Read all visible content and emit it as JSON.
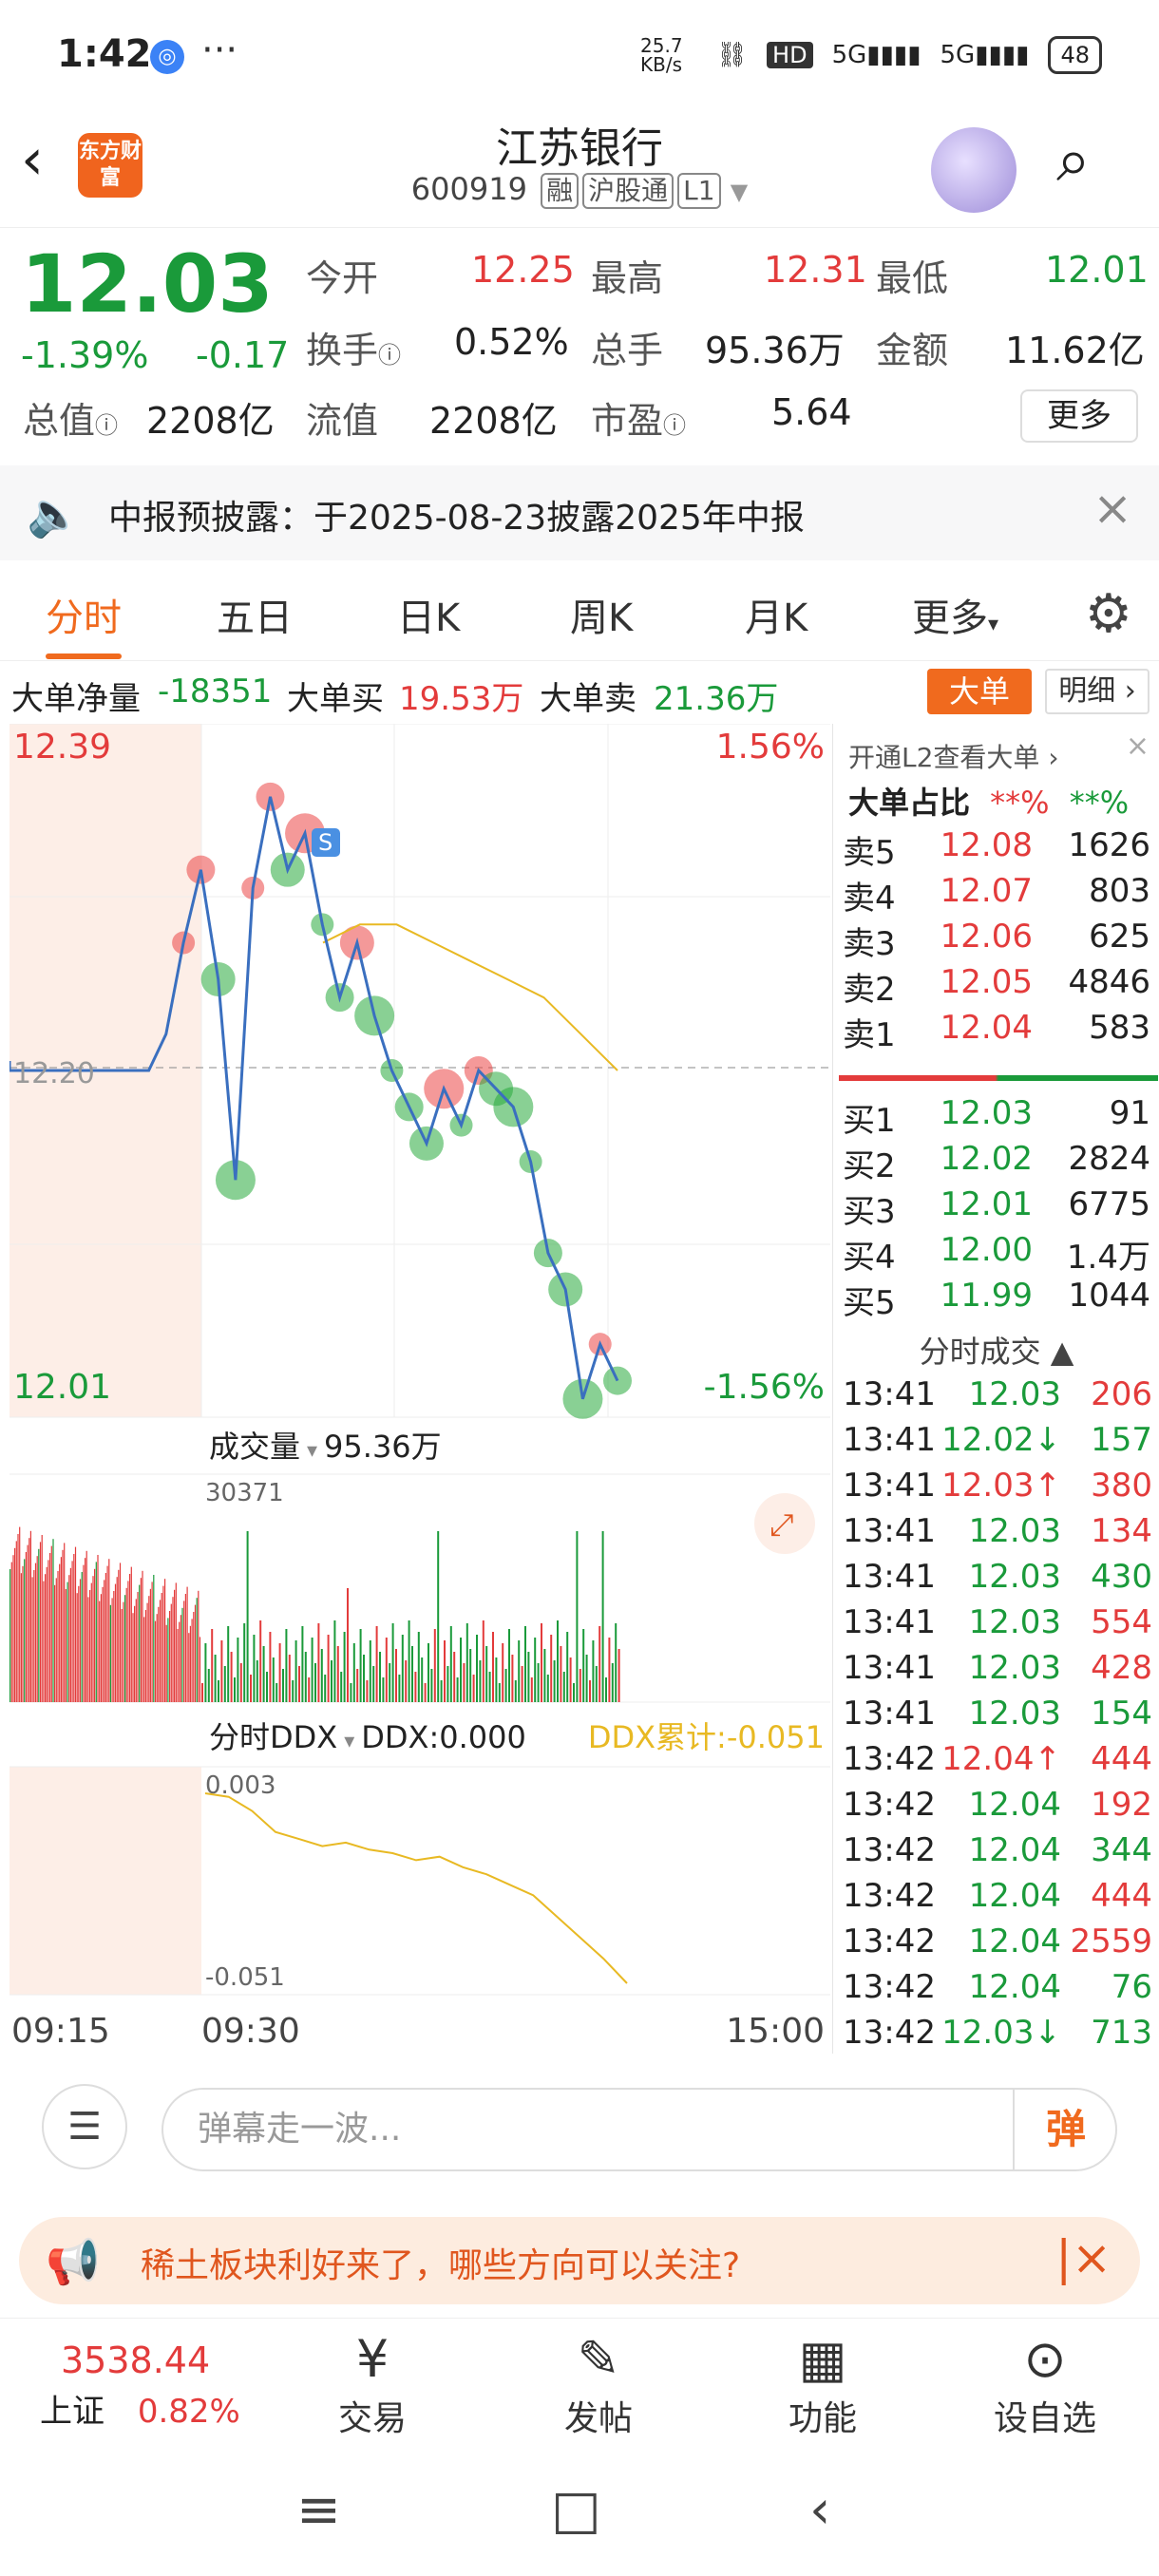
{
  "status_bar": {
    "time": "1:42",
    "dots": "···",
    "net_speed": "25.7 KB/s",
    "hd": "HD",
    "sig1": "5G",
    "sig2": "5G",
    "battery": "48"
  },
  "header": {
    "logo": "东方财富",
    "title": "江苏银行",
    "code": "600919",
    "tags": [
      "融",
      "沪股通",
      "L1"
    ]
  },
  "quote": {
    "price": "12.03",
    "change_pct": "-1.39%",
    "change": "-0.17",
    "fields": [
      {
        "label": "今开",
        "value": "12.25",
        "color": "red"
      },
      {
        "label": "最高",
        "value": "12.31",
        "color": "red"
      },
      {
        "label": "最低",
        "value": "12.01",
        "color": "green"
      },
      {
        "label": "换手",
        "value": "0.52%",
        "color": "plain"
      },
      {
        "label": "总手",
        "value": "95.36万",
        "color": "plain"
      },
      {
        "label": "金额",
        "value": "11.62亿",
        "color": "plain"
      },
      {
        "label": "总值",
        "value": "2208亿",
        "color": "plain"
      },
      {
        "label": "流值",
        "value": "2208亿",
        "color": "plain"
      },
      {
        "label": "市盈",
        "value": "5.64",
        "color": "plain"
      }
    ],
    "more_label": "更多"
  },
  "notice": {
    "text": "中报预披露：于2025-08-23披露2025年中报"
  },
  "tabs": [
    "分时",
    "五日",
    "日K",
    "周K",
    "月K",
    "更多"
  ],
  "big_order": {
    "net_label": "大单净量",
    "net_value": "-18351",
    "buy_label": "大单买",
    "buy_value": "19.53万",
    "sell_label": "大单卖",
    "sell_value": "21.36万",
    "btn_big": "大单",
    "btn_detail": "明细"
  },
  "chart_data": {
    "type": "line",
    "price_high_label": "12.39",
    "price_low_label": "12.01",
    "pct_high_label": "1.56%",
    "pct_low_label": "-1.56%",
    "ref_price_label": "12.20",
    "volume_label": "成交量",
    "volume_value": "95.36万",
    "volume_max_label": "30371",
    "ddx_label": "分时DDX",
    "ddx_value": "DDX:0.000",
    "ddx_cum": "DDX累计:-0.051",
    "ddx_max_label": "0.003",
    "ddx_min_label": "-0.051",
    "time_labels": [
      "09:15",
      "09:30",
      "15:00"
    ],
    "price": [
      12.2,
      12.2,
      12.2,
      12.22,
      12.27,
      12.31,
      12.25,
      12.14,
      12.3,
      12.35,
      12.31,
      12.33,
      12.28,
      12.24,
      12.27,
      12.23,
      12.2,
      12.18,
      12.16,
      12.19,
      12.17,
      12.2,
      12.19,
      12.18,
      12.15,
      12.1,
      12.08,
      12.02,
      12.05,
      12.03
    ],
    "avg": [
      12.27,
      12.28,
      12.28,
      12.27,
      12.26,
      12.25,
      12.24,
      12.22,
      12.2
    ]
  },
  "order_book": {
    "l2_label": "开通L2查看大单",
    "ratio_label": "大单占比",
    "ratio_a": "**%",
    "ratio_b": "**%",
    "sells": [
      {
        "label": "卖5",
        "price": "12.08",
        "vol": "1626"
      },
      {
        "label": "卖4",
        "price": "12.07",
        "vol": "803"
      },
      {
        "label": "卖3",
        "price": "12.06",
        "vol": "625"
      },
      {
        "label": "卖2",
        "price": "12.05",
        "vol": "4846"
      },
      {
        "label": "卖1",
        "price": "12.04",
        "vol": "583"
      }
    ],
    "buys": [
      {
        "label": "买1",
        "price": "12.03",
        "vol": "91"
      },
      {
        "label": "买2",
        "price": "12.02",
        "vol": "2824"
      },
      {
        "label": "买3",
        "price": "12.01",
        "vol": "6775"
      },
      {
        "label": "买4",
        "price": "12.00",
        "vol": "1.4万"
      },
      {
        "label": "买5",
        "price": "11.99",
        "vol": "1044"
      }
    ],
    "trades_label": "分时成交",
    "trades": [
      {
        "time": "13:41",
        "price": "12.03",
        "vol": "206",
        "dir": ""
      },
      {
        "time": "13:41",
        "price": "12.02",
        "vol": "157",
        "dir": "↓"
      },
      {
        "time": "13:41",
        "price": "12.03",
        "vol": "380",
        "dir": "↑"
      },
      {
        "time": "13:41",
        "price": "12.03",
        "vol": "134",
        "dir": ""
      },
      {
        "time": "13:41",
        "price": "12.03",
        "vol": "430",
        "dir": ""
      },
      {
        "time": "13:41",
        "price": "12.03",
        "vol": "554",
        "dir": ""
      },
      {
        "time": "13:41",
        "price": "12.03",
        "vol": "428",
        "dir": ""
      },
      {
        "time": "13:41",
        "price": "12.03",
        "vol": "154",
        "dir": ""
      },
      {
        "time": "13:42",
        "price": "12.04",
        "vol": "444",
        "dir": "↑"
      },
      {
        "time": "13:42",
        "price": "12.04",
        "vol": "192",
        "dir": ""
      },
      {
        "time": "13:42",
        "price": "12.04",
        "vol": "344",
        "dir": ""
      },
      {
        "time": "13:42",
        "price": "12.04",
        "vol": "444",
        "dir": ""
      },
      {
        "time": "13:42",
        "price": "12.04",
        "vol": "2559",
        "dir": ""
      },
      {
        "time": "13:42",
        "price": "12.04",
        "vol": "76",
        "dir": ""
      },
      {
        "time": "13:42",
        "price": "12.03",
        "vol": "713",
        "dir": "↓"
      }
    ]
  },
  "comment": {
    "placeholder": "弹幕走一波...",
    "danmu": "弹"
  },
  "promo": {
    "text": "稀土板块利好来了，哪些方向可以关注?"
  },
  "bottom_nav": {
    "index_value": "3538.44",
    "index_name": "上证",
    "index_pct": "0.82%",
    "items": [
      "交易",
      "发帖",
      "功能",
      "设自选"
    ]
  }
}
